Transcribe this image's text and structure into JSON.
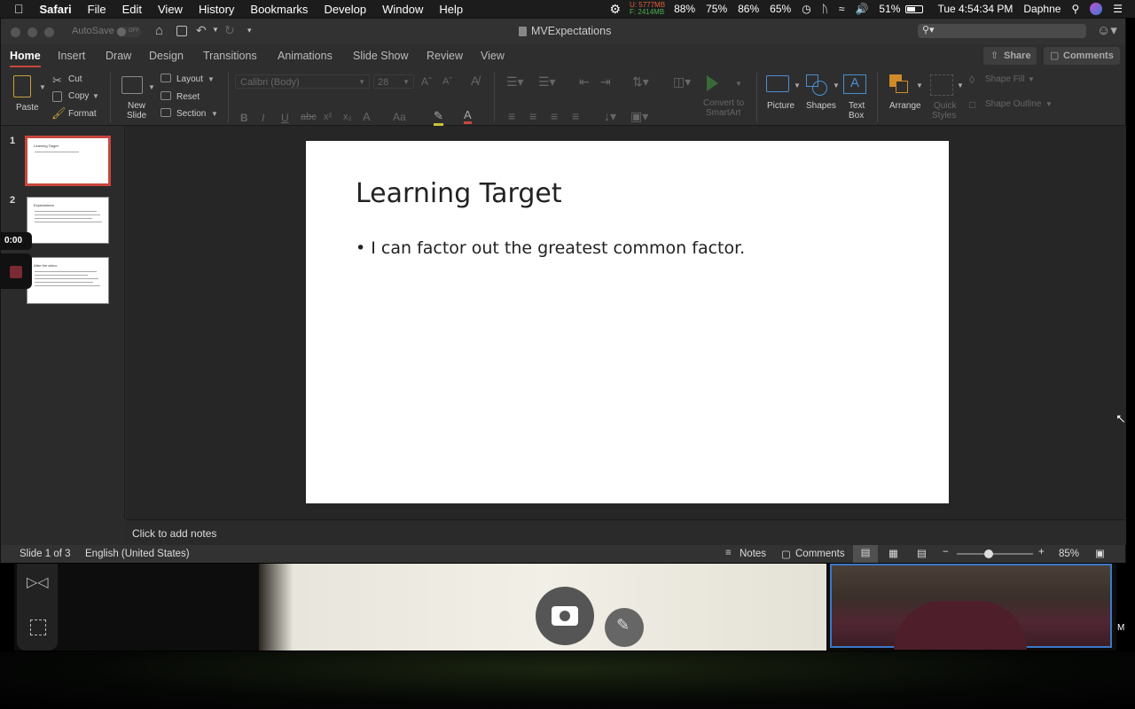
{
  "menubar": {
    "app": "Safari",
    "items": [
      "File",
      "Edit",
      "View",
      "History",
      "Bookmarks",
      "Develop",
      "Window",
      "Help"
    ],
    "mem_used": "U: 5777MB",
    "mem_free": "F: 2414MB",
    "stats": [
      "88%",
      "75%",
      "86%",
      "65%"
    ],
    "battery": "51%",
    "clock": "Tue 4:54:34 PM",
    "user": "Daphne"
  },
  "window": {
    "autosave": "AutoSave",
    "autosave_state": "OFF",
    "doc_title": "MVExpectations",
    "share": "Share",
    "comments": "Comments"
  },
  "tabs": [
    "Home",
    "Insert",
    "Draw",
    "Design",
    "Transitions",
    "Animations",
    "Slide Show",
    "Review",
    "View"
  ],
  "ribbon": {
    "paste": "Paste",
    "cut": "Cut",
    "copy": "Copy",
    "format": "Format",
    "new_slide_1": "New",
    "new_slide_2": "Slide",
    "layout": "Layout",
    "reset": "Reset",
    "section": "Section",
    "font": "Calibri (Body)",
    "size": "28",
    "convert_1": "Convert to",
    "convert_2": "SmartArt",
    "picture": "Picture",
    "shapes": "Shapes",
    "textbox_1": "Text",
    "textbox_2": "Box",
    "arrange": "Arrange",
    "quick_1": "Quick",
    "quick_2": "Styles",
    "shape_fill": "Shape Fill",
    "shape_outline": "Shape Outline"
  },
  "thumbnails": [
    {
      "num": "1",
      "title": "Learning Target",
      "selected": true
    },
    {
      "num": "2",
      "title": "Expectations",
      "selected": false
    },
    {
      "num": "",
      "title": "After the video:",
      "selected": false
    }
  ],
  "timer": "0:00",
  "slide": {
    "title": "Learning Target",
    "bullet": "I can factor out the greatest common factor."
  },
  "notes_placeholder": "Click to add notes",
  "status": {
    "slide": "Slide 1 of 3",
    "language": "English (United States)",
    "notes": "Notes",
    "comments": "Comments",
    "zoom": "85%"
  },
  "colors": {
    "accent": "#c9463d",
    "window_bg": "#2b2b2b",
    "slide_bg": "#ffffff"
  }
}
